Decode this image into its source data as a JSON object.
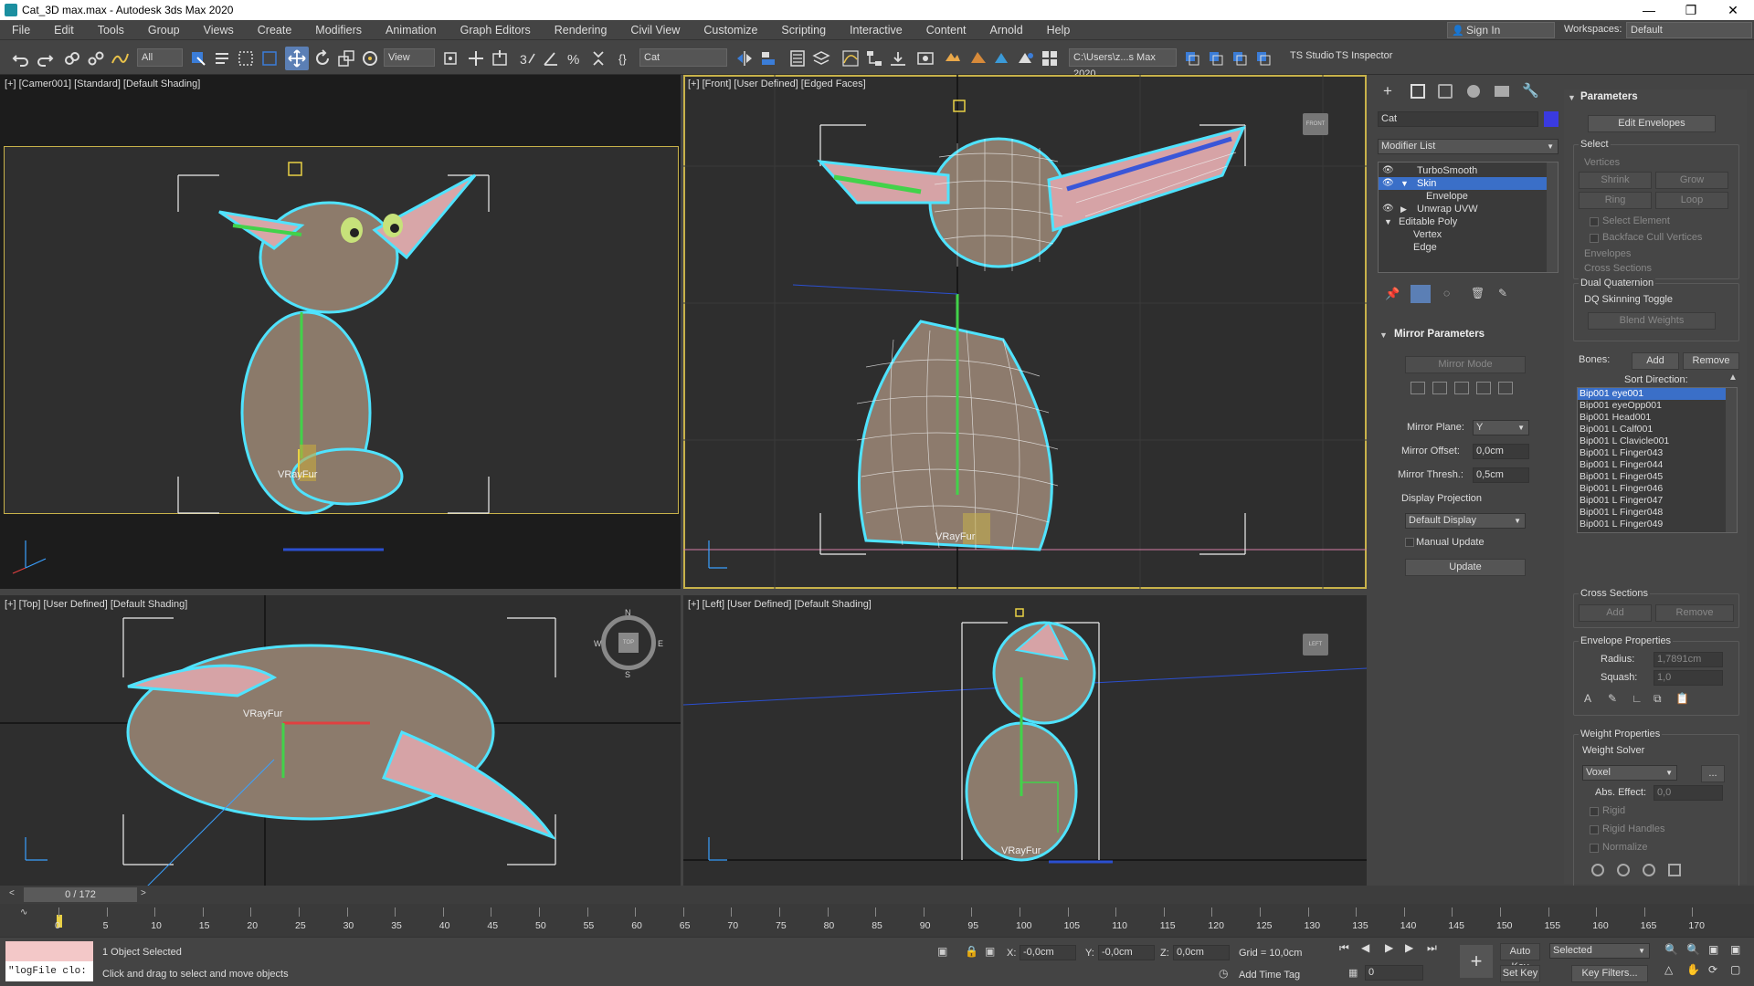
{
  "window": {
    "title": "Cat_3D max.max - Autodesk 3ds Max 2020",
    "controls": [
      "—",
      "❐",
      "✕"
    ]
  },
  "menu": [
    "File",
    "Edit",
    "Tools",
    "Group",
    "Views",
    "Create",
    "Modifiers",
    "Animation",
    "Graph Editors",
    "Rendering",
    "Civil View",
    "Customize",
    "Scripting",
    "Interactive",
    "Content",
    "Arnold",
    "Help"
  ],
  "account": {
    "sign_in": "Sign In",
    "workspaces_label": "Workspaces:",
    "workspace": "Default"
  },
  "toolbar": {
    "selection_filter": "All",
    "ref_coord": "View",
    "named_selection": "Cat",
    "project_path": "C:\\Users\\z...s Max 2020",
    "ts_studio": "TS Studio",
    "ts_inspector": "TS Inspector"
  },
  "viewports": {
    "camera": {
      "label": "[+] [Camer001] [Standard] [Default Shading]",
      "fur_label": "VRayFur"
    },
    "front": {
      "label": "[+] [Front] [User Defined] [Edged Faces]",
      "fur_label": "VRayFur",
      "cube": "FRONT"
    },
    "top": {
      "label": "[+] [Top] [User Defined] [Default Shading]",
      "fur_label": "VRayFur",
      "compass": [
        "N",
        "E",
        "S",
        "W"
      ],
      "cube": "TOP"
    },
    "left": {
      "label": "[+] [Left] [User Defined] [Default Shading]",
      "fur_label": "VRayFur",
      "cube": "LEFT"
    }
  },
  "command_panel": {
    "object_name": "Cat",
    "object_color": "#3a3ae0",
    "modifier_list": "Modifier List",
    "stack": [
      {
        "label": "TurboSmooth",
        "eye": true,
        "selected": false,
        "indent": 0
      },
      {
        "label": "Skin",
        "eye": true,
        "selected": true,
        "indent": 0
      },
      {
        "label": "Envelope",
        "eye": false,
        "selected": false,
        "indent": 1
      },
      {
        "label": "Unwrap UVW",
        "eye": true,
        "selected": false,
        "indent": 0
      },
      {
        "label": "Editable Poly",
        "eye": false,
        "selected": false,
        "indent": 0
      },
      {
        "label": "Vertex",
        "eye": false,
        "selected": false,
        "indent": 1
      },
      {
        "label": "Edge",
        "eye": false,
        "selected": false,
        "indent": 1
      }
    ],
    "mirror": {
      "title": "Mirror Parameters",
      "mirror_mode": "Mirror Mode",
      "plane_label": "Mirror Plane:",
      "plane": "Y",
      "offset_label": "Mirror Offset:",
      "offset": "0,0cm",
      "thresh_label": "Mirror Thresh.:",
      "thresh": "0,5cm",
      "display_projection": "Display Projection",
      "projection": "Default Display",
      "manual_update": "Manual Update",
      "update": "Update"
    },
    "parameters": {
      "title": "Parameters",
      "edit_envelopes": "Edit Envelopes",
      "select_label": "Select",
      "vertices": "Vertices",
      "shrink": "Shrink",
      "grow": "Grow",
      "ring": "Ring",
      "loop": "Loop",
      "select_element": "Select Element",
      "backface": "Backface Cull Vertices",
      "envelopes": "Envelopes",
      "cross_sections": "Cross Sections",
      "dq_label": "Dual Quaternion",
      "dq_toggle": "DQ Skinning Toggle",
      "blend_weights": "Blend Weights",
      "bones_label": "Bones:",
      "add": "Add",
      "remove": "Remove",
      "sort_direction": "Sort Direction:",
      "bones": [
        "Bip001 eye001",
        "Bip001 eyeOpp001",
        "Bip001 Head001",
        "Bip001 L Calf001",
        "Bip001 L Clavicle001",
        "Bip001 L Finger043",
        "Bip001 L Finger044",
        "Bip001 L Finger045",
        "Bip001 L Finger046",
        "Bip001 L Finger047",
        "Bip001 L Finger048",
        "Bip001 L Finger049"
      ],
      "cross_sections_group": "Cross Sections",
      "cs_add": "Add",
      "cs_remove": "Remove",
      "envelope_props": "Envelope Properties",
      "radius_label": "Radius:",
      "radius": "1,7891cm",
      "squash_label": "Squash:",
      "squash": "1,0",
      "weight_props": "Weight Properties",
      "weight_solver": "Weight Solver",
      "solver": "Voxel",
      "solver_more": "...",
      "abs_effect_label": "Abs. Effect:",
      "abs_effect": "0,0",
      "rigid": "Rigid",
      "rigid_handles": "Rigid Handles",
      "normalize": "Normalize"
    }
  },
  "timeline": {
    "frame": "0 / 172",
    "ticks": [
      "0",
      "5",
      "10",
      "15",
      "20",
      "25",
      "30",
      "35",
      "40",
      "45",
      "50",
      "55",
      "60",
      "65",
      "70",
      "75",
      "80",
      "85",
      "90",
      "95",
      "100",
      "105",
      "110",
      "115",
      "120",
      "125",
      "130",
      "135",
      "140",
      "145",
      "150",
      "155",
      "160",
      "165",
      "170"
    ]
  },
  "status": {
    "script_listener": "\"logFile clo:",
    "selection": "1 Object Selected",
    "prompt": "Click and drag to select and move objects",
    "x_label": "X:",
    "x": "-0,0cm",
    "y_label": "Y:",
    "y": "-0,0cm",
    "z_label": "Z:",
    "z": "0,0cm",
    "grid": "Grid = 10,0cm",
    "add_time_tag": "Add Time Tag",
    "auto_key": "Auto Key",
    "set_key": "Set Key",
    "key_mode": "Selected",
    "key_filters": "Key Filters...",
    "current_frame": "0"
  }
}
